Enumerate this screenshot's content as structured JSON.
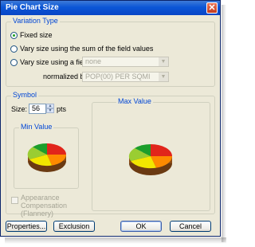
{
  "window": {
    "title": "Pie Chart Size",
    "close_symbol": "✕"
  },
  "variation": {
    "legend": "Variation Type",
    "fixed": "Fixed size",
    "sum": "Vary size using the sum of the field values",
    "field": "Vary size using a field:",
    "field_value": "none",
    "normalized_label": "normalized by:",
    "normalized_value": "POP(00) PER SQMI"
  },
  "symbol": {
    "legend": "Symbol",
    "size_label": "Size:",
    "size_value": "56",
    "size_unit": "pts",
    "min_legend": "Min Value",
    "max_legend": "Max Value",
    "appearance_label": "Appearance Compensation (Flannery)"
  },
  "buttons": {
    "properties": "Properties...",
    "exclusion": "Exclusion",
    "ok": "OK",
    "cancel": "Cancel"
  },
  "colors": {
    "slice_red": "#e1251b",
    "slice_orange": "#ff8a00",
    "slice_yellow": "#f2e600",
    "slice_lime": "#9acd32",
    "slice_green": "#1c9e2b"
  }
}
